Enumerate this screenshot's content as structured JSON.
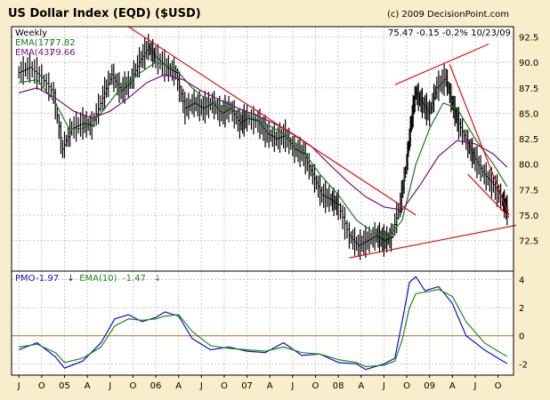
{
  "header": {
    "title": "US Dollar Index (EQD) ($USD)",
    "copyright": "(c) 2009 DecisionPoint.com"
  },
  "chart_data": [
    {
      "type": "ohlc",
      "period": "Weekly",
      "readout": "75.47  -0.15  -0.2%  10/23/09",
      "legend": [
        {
          "name": "EMA(17)",
          "value": "77.82",
          "color": "#1a7a1a"
        },
        {
          "name": "EMA(43)",
          "value": "79.66",
          "color": "#7a0f7a"
        }
      ],
      "ylim": [
        69.5,
        93.5
      ],
      "y_ticks": [
        "72.5",
        "75.0",
        "77.5",
        "80.0",
        "82.5",
        "85.0",
        "87.5",
        "90.0",
        "92.5"
      ],
      "series": [
        {
          "name": "Close",
          "color": "#000000",
          "points": [
            [
              2004.5,
              89.0
            ],
            [
              2004.62,
              89.5
            ],
            [
              2004.75,
              88.5
            ],
            [
              2004.88,
              87.0
            ],
            [
              2004.98,
              81.5
            ],
            [
              2005.08,
              83.5
            ],
            [
              2005.2,
              84.0
            ],
            [
              2005.3,
              83.8
            ],
            [
              2005.42,
              86.5
            ],
            [
              2005.52,
              88.8
            ],
            [
              2005.62,
              87.2
            ],
            [
              2005.72,
              88.0
            ],
            [
              2005.82,
              90.0
            ],
            [
              2005.92,
              91.5
            ],
            [
              2006.0,
              90.5
            ],
            [
              2006.12,
              89.5
            ],
            [
              2006.22,
              89.0
            ],
            [
              2006.32,
              85.5
            ],
            [
              2006.42,
              86.0
            ],
            [
              2006.52,
              85.5
            ],
            [
              2006.62,
              86.0
            ],
            [
              2006.72,
              85.0
            ],
            [
              2006.82,
              85.5
            ],
            [
              2006.92,
              84.0
            ],
            [
              2007.0,
              84.5
            ],
            [
              2007.12,
              84.2
            ],
            [
              2007.22,
              83.0
            ],
            [
              2007.32,
              82.5
            ],
            [
              2007.42,
              82.8
            ],
            [
              2007.52,
              81.5
            ],
            [
              2007.62,
              81.0
            ],
            [
              2007.72,
              79.0
            ],
            [
              2007.82,
              77.0
            ],
            [
              2007.92,
              76.5
            ],
            [
              2008.0,
              76.0
            ],
            [
              2008.12,
              73.0
            ],
            [
              2008.22,
              72.0
            ],
            [
              2008.32,
              72.5
            ],
            [
              2008.42,
              73.0
            ],
            [
              2008.5,
              72.5
            ],
            [
              2008.58,
              72.8
            ],
            [
              2008.68,
              76.0
            ],
            [
              2008.75,
              80.0
            ],
            [
              2008.8,
              84.0
            ],
            [
              2008.85,
              87.0
            ],
            [
              2008.92,
              86.0
            ],
            [
              2009.0,
              85.0
            ],
            [
              2009.08,
              87.5
            ],
            [
              2009.18,
              88.5
            ],
            [
              2009.25,
              86.0
            ],
            [
              2009.32,
              84.0
            ],
            [
              2009.42,
              82.0
            ],
            [
              2009.5,
              80.5
            ],
            [
              2009.6,
              79.0
            ],
            [
              2009.7,
              78.0
            ],
            [
              2009.8,
              76.5
            ],
            [
              2009.85,
              75.5
            ]
          ]
        },
        {
          "name": "EMA(17)",
          "color": "#1a7a1a",
          "points": [
            [
              2004.5,
              88.0
            ],
            [
              2004.7,
              88.3
            ],
            [
              2004.9,
              86.0
            ],
            [
              2005.05,
              83.5
            ],
            [
              2005.2,
              83.5
            ],
            [
              2005.4,
              85.0
            ],
            [
              2005.6,
              87.3
            ],
            [
              2005.8,
              88.8
            ],
            [
              2006.0,
              90.0
            ],
            [
              2006.2,
              89.5
            ],
            [
              2006.4,
              87.5
            ],
            [
              2006.6,
              86.0
            ],
            [
              2006.8,
              85.5
            ],
            [
              2007.0,
              84.8
            ],
            [
              2007.2,
              84.0
            ],
            [
              2007.4,
              83.0
            ],
            [
              2007.6,
              81.5
            ],
            [
              2007.8,
              79.0
            ],
            [
              2008.0,
              77.0
            ],
            [
              2008.2,
              74.5
            ],
            [
              2008.4,
              73.2
            ],
            [
              2008.55,
              72.8
            ],
            [
              2008.7,
              74.5
            ],
            [
              2008.85,
              80.0
            ],
            [
              2009.0,
              83.5
            ],
            [
              2009.15,
              86.0
            ],
            [
              2009.3,
              85.5
            ],
            [
              2009.5,
              82.5
            ],
            [
              2009.7,
              80.0
            ],
            [
              2009.85,
              77.8
            ]
          ]
        },
        {
          "name": "EMA(43)",
          "color": "#7a0f7a",
          "points": [
            [
              2004.5,
              87.0
            ],
            [
              2004.7,
              87.5
            ],
            [
              2004.9,
              86.5
            ],
            [
              2005.1,
              85.2
            ],
            [
              2005.3,
              84.5
            ],
            [
              2005.5,
              85.2
            ],
            [
              2005.7,
              86.5
            ],
            [
              2005.9,
              88.0
            ],
            [
              2006.1,
              88.8
            ],
            [
              2006.3,
              88.3
            ],
            [
              2006.5,
              87.2
            ],
            [
              2006.7,
              86.3
            ],
            [
              2006.9,
              85.5
            ],
            [
              2007.1,
              84.8
            ],
            [
              2007.3,
              84.0
            ],
            [
              2007.5,
              83.0
            ],
            [
              2007.7,
              81.8
            ],
            [
              2007.9,
              80.0
            ],
            [
              2008.1,
              78.3
            ],
            [
              2008.3,
              76.8
            ],
            [
              2008.5,
              75.8
            ],
            [
              2008.7,
              75.5
            ],
            [
              2008.9,
              78.0
            ],
            [
              2009.1,
              80.8
            ],
            [
              2009.3,
              82.3
            ],
            [
              2009.5,
              82.0
            ],
            [
              2009.7,
              81.0
            ],
            [
              2009.85,
              79.7
            ]
          ]
        },
        {
          "name": "trendline",
          "color": "#e01010",
          "points": [
            [
              2005.7,
              93.5
            ],
            [
              2008.85,
              75.0
            ]
          ]
        },
        {
          "name": "trendline",
          "color": "#e01010",
          "points": [
            [
              2008.62,
              87.8
            ],
            [
              2009.65,
              91.8
            ]
          ]
        },
        {
          "name": "trendline",
          "color": "#e01010",
          "points": [
            [
              2008.12,
              70.8
            ],
            [
              2009.95,
              74.0
            ]
          ]
        },
        {
          "name": "trendline",
          "color": "#e01010",
          "points": [
            [
              2009.22,
              89.8
            ],
            [
              2009.87,
              75.0
            ]
          ]
        },
        {
          "name": "trendline",
          "color": "#e01010",
          "points": [
            [
              2009.42,
              79.0
            ],
            [
              2009.87,
              74.8
            ]
          ]
        }
      ]
    },
    {
      "type": "line",
      "legend": [
        {
          "name": "PMO",
          "value": "-1.97",
          "color": "#1010d0",
          "arrow": "↓"
        },
        {
          "name": "EMA(10)",
          "value": "-1.47",
          "color": "#1a8a1a",
          "arrow": "↓"
        }
      ],
      "ylim": [
        -2.8,
        4.6
      ],
      "y_ticks": [
        "-2",
        "0",
        "2",
        "4"
      ],
      "zero_line_color": "#c86414",
      "series": [
        {
          "name": "PMO",
          "color": "#1010d0",
          "points": [
            [
              2004.5,
              -1.0
            ],
            [
              2004.7,
              -0.5
            ],
            [
              2004.9,
              -1.5
            ],
            [
              2005.0,
              -2.3
            ],
            [
              2005.2,
              -1.8
            ],
            [
              2005.4,
              -0.5
            ],
            [
              2005.55,
              1.2
            ],
            [
              2005.7,
              1.5
            ],
            [
              2005.85,
              1.0
            ],
            [
              2006.0,
              1.3
            ],
            [
              2006.1,
              1.7
            ],
            [
              2006.25,
              1.4
            ],
            [
              2006.4,
              -0.2
            ],
            [
              2006.6,
              -1.0
            ],
            [
              2006.8,
              -0.8
            ],
            [
              2007.0,
              -1.1
            ],
            [
              2007.2,
              -1.2
            ],
            [
              2007.4,
              -0.5
            ],
            [
              2007.6,
              -1.4
            ],
            [
              2007.8,
              -1.3
            ],
            [
              2008.0,
              -1.9
            ],
            [
              2008.2,
              -2.0
            ],
            [
              2008.3,
              -2.4
            ],
            [
              2008.5,
              -2.0
            ],
            [
              2008.62,
              -1.6
            ],
            [
              2008.7,
              1.0
            ],
            [
              2008.78,
              3.8
            ],
            [
              2008.85,
              4.2
            ],
            [
              2008.95,
              3.2
            ],
            [
              2009.1,
              3.5
            ],
            [
              2009.25,
              2.3
            ],
            [
              2009.4,
              0.0
            ],
            [
              2009.6,
              -1.0
            ],
            [
              2009.75,
              -1.6
            ],
            [
              2009.85,
              -1.97
            ]
          ]
        },
        {
          "name": "EMA(10)",
          "color": "#1a8a1a",
          "points": [
            [
              2004.5,
              -0.8
            ],
            [
              2004.7,
              -0.6
            ],
            [
              2004.9,
              -1.2
            ],
            [
              2005.0,
              -1.9
            ],
            [
              2005.2,
              -1.6
            ],
            [
              2005.4,
              -0.8
            ],
            [
              2005.55,
              0.7
            ],
            [
              2005.7,
              1.2
            ],
            [
              2005.85,
              1.1
            ],
            [
              2006.0,
              1.2
            ],
            [
              2006.1,
              1.4
            ],
            [
              2006.25,
              1.5
            ],
            [
              2006.4,
              0.3
            ],
            [
              2006.6,
              -0.7
            ],
            [
              2006.8,
              -0.9
            ],
            [
              2007.0,
              -1.0
            ],
            [
              2007.2,
              -1.1
            ],
            [
              2007.4,
              -0.8
            ],
            [
              2007.6,
              -1.2
            ],
            [
              2007.8,
              -1.3
            ],
            [
              2008.0,
              -1.7
            ],
            [
              2008.2,
              -1.9
            ],
            [
              2008.3,
              -2.2
            ],
            [
              2008.5,
              -2.1
            ],
            [
              2008.62,
              -1.8
            ],
            [
              2008.7,
              -0.3
            ],
            [
              2008.78,
              2.0
            ],
            [
              2008.85,
              3.0
            ],
            [
              2008.95,
              3.1
            ],
            [
              2009.1,
              3.3
            ],
            [
              2009.25,
              2.8
            ],
            [
              2009.4,
              1.0
            ],
            [
              2009.6,
              -0.5
            ],
            [
              2009.75,
              -1.1
            ],
            [
              2009.85,
              -1.47
            ]
          ]
        }
      ]
    }
  ],
  "x_axis": {
    "labels": [
      "J",
      "O",
      "05",
      "A",
      "J",
      "O",
      "06",
      "A",
      "J",
      "O",
      "07",
      "A",
      "J",
      "O",
      "08",
      "A",
      "J",
      "O",
      "09",
      "A",
      "J",
      "O"
    ],
    "positions": [
      2004.5,
      2004.75,
      2005.0,
      2005.25,
      2005.5,
      2005.75,
      2006.0,
      2006.25,
      2006.5,
      2006.75,
      2007.0,
      2007.25,
      2007.5,
      2007.75,
      2008.0,
      2008.25,
      2008.5,
      2008.75,
      2009.0,
      2009.25,
      2009.5,
      2009.75
    ],
    "range": [
      2004.42,
      2009.92
    ]
  }
}
